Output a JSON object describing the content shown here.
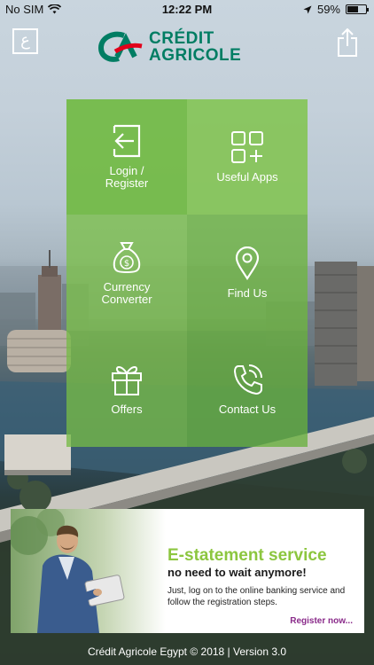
{
  "status_bar": {
    "carrier": "No SIM",
    "time": "12:22 PM",
    "battery": "59%",
    "battery_level": 0.59
  },
  "header": {
    "lang_toggle": "ع",
    "logo_line1": "CRÉDIT",
    "logo_line2": "AGRICOLE"
  },
  "menu": {
    "login": "Login /\nRegister",
    "useful_apps": "Useful Apps",
    "currency": "Currency\nConverter",
    "find_us": "Find Us",
    "offers": "Offers",
    "contact_us": "Contact Us"
  },
  "banner": {
    "title": "E-statement service",
    "subtitle": "no need to wait anymore!",
    "body": "Just, log on to the online banking service and follow the registration steps.",
    "link": "Register now..."
  },
  "footer": {
    "text": "Crédit Agricole Egypt © 2018 | Version 3.0"
  },
  "colors": {
    "brand_green": "#007d63",
    "tile_green": "#72ba45",
    "accent_green": "#8cc63f",
    "link_purple": "#8a2b8a"
  },
  "icons": {
    "login": "login-arrow-icon",
    "useful_apps": "apps-grid-plus-icon",
    "currency": "money-bag-icon",
    "find_us": "map-pin-icon",
    "offers": "gift-icon",
    "contact_us": "phone-ringing-icon",
    "share": "share-icon"
  }
}
